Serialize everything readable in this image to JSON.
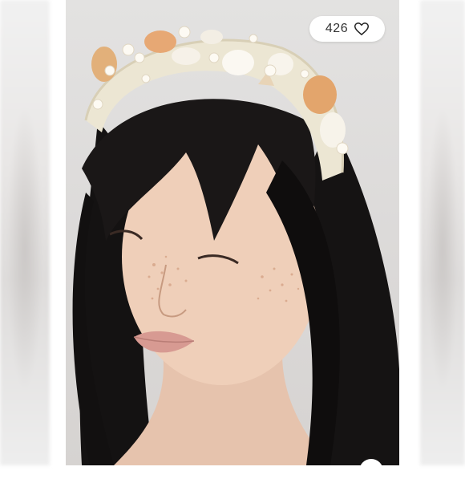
{
  "likes": {
    "count": "426",
    "icon": "heart-outline-icon"
  },
  "photo": {
    "subject": "product-photo"
  }
}
